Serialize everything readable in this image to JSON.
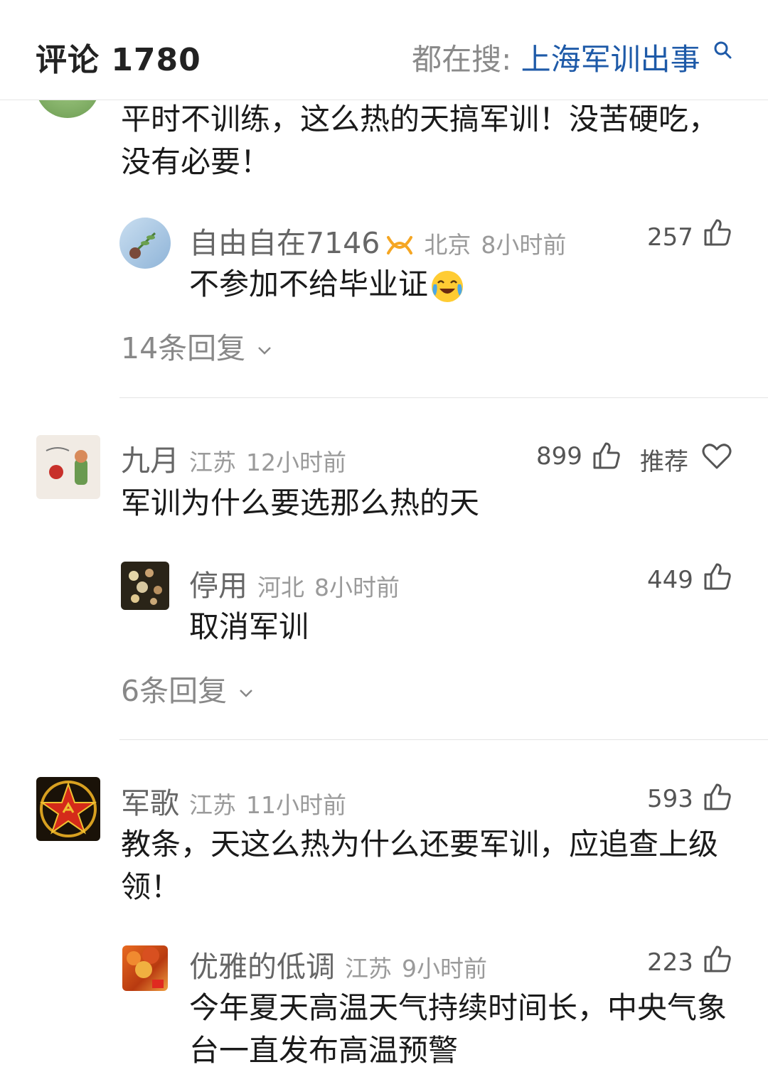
{
  "header": {
    "title": "评论 1780",
    "hot_search_label": "都在搜:",
    "hot_search_term": "上海军训出事"
  },
  "comments": [
    {
      "text": "平时不训练，这么热的天搞军训！没苦硬吃，没有必要！",
      "reply": {
        "username": "自由自在7146",
        "location": "北京",
        "time": "8小时前",
        "likes": "257",
        "text": "不参加不给毕业证"
      },
      "more_replies": "14条回复"
    },
    {
      "username": "九月",
      "location": "江苏",
      "time": "12小时前",
      "likes": "899",
      "recommend_label": "推荐",
      "text": "军训为什么要选那么热的天",
      "reply": {
        "username": "停用",
        "location": "河北",
        "time": "8小时前",
        "likes": "449",
        "text": "取消军训"
      },
      "more_replies": "6条回复"
    },
    {
      "username": "军歌",
      "location": "江苏",
      "time": "11小时前",
      "likes": "593",
      "text": "教条，天这么热为什么还要军训，应追查上级领！",
      "reply": {
        "username": "优雅的低调",
        "location": "江苏",
        "time": "9小时前",
        "likes": "223",
        "text": "今年夏天高温天气持续时间长，中央气象台一直发布高温预警"
      }
    }
  ],
  "icons": {
    "like": "thumb-up-icon",
    "recommend": "heart-icon",
    "expand": "chevron-down-icon",
    "search": "search-icon",
    "vip": "vip-badge-icon",
    "emoji": "crying-laughing-emoji-icon"
  },
  "colors": {
    "accent": "#1e5aa8",
    "vip": "#f5a623",
    "text": "#1a1a1a",
    "muted": "#9a9a9a"
  }
}
